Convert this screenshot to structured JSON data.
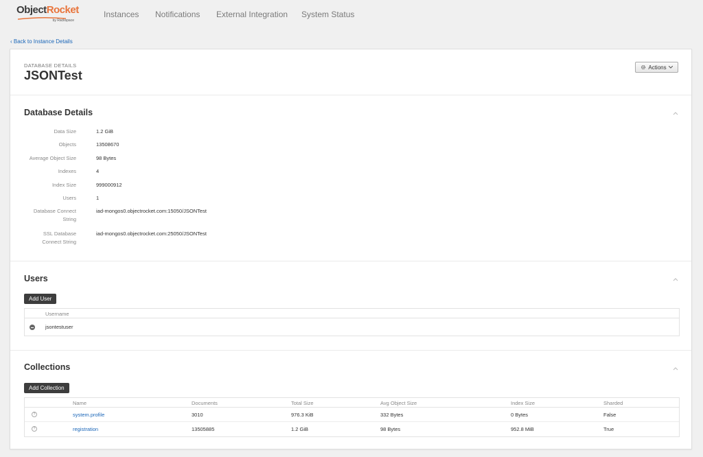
{
  "app": {
    "logo_main": "Object",
    "logo_accent": "Rocket",
    "logo_sub": "by Rackspace",
    "brand_color": "#e8743b"
  },
  "nav": {
    "items": [
      {
        "label": "Instances"
      },
      {
        "label": "Notifications"
      },
      {
        "label": "External Integration"
      },
      {
        "label": "System Status"
      }
    ]
  },
  "breadcrumb": {
    "back_label": "‹ Back to Instance Details"
  },
  "header": {
    "section_label": "DATABASE DETAILS",
    "title": "JSONTest",
    "actions_label": "Actions",
    "actions_icon": "gear-icon"
  },
  "database_details": {
    "title": "Database Details",
    "rows": [
      {
        "label": "Data Size",
        "value": "1.2 GiB"
      },
      {
        "label": "Objects",
        "value": "13508670"
      },
      {
        "label": "Average Object Size",
        "value": "98 Bytes"
      },
      {
        "label": "Indexes",
        "value": "4"
      },
      {
        "label": "Index Size",
        "value": "999000912"
      },
      {
        "label": "Users",
        "value": "1"
      },
      {
        "label": "Database Connect String",
        "value": "iad-mongos0.objectrocket.com:15050/JSONTest"
      },
      {
        "label": "SSL Database Connect String",
        "value": "iad-mongos0.objectrocket.com:25050/JSONTest"
      }
    ]
  },
  "users": {
    "title": "Users",
    "add_label": "Add User",
    "columns": [
      "Username"
    ],
    "rows": [
      {
        "username": "jsontestuser"
      }
    ]
  },
  "collections": {
    "title": "Collections",
    "add_label": "Add Collection",
    "columns": [
      "Name",
      "Documents",
      "Total Size",
      "Avg Object Size",
      "Index Size",
      "Sharded"
    ],
    "rows": [
      {
        "name": "system.profile",
        "documents": "3010",
        "total_size": "976.3 KiB",
        "avg_object_size": "332 Bytes",
        "index_size": "0 Bytes",
        "sharded": "False"
      },
      {
        "name": "registration",
        "documents": "13505885",
        "total_size": "1.2 GiB",
        "avg_object_size": "98 Bytes",
        "index_size": "952.8 MiB",
        "sharded": "True"
      }
    ]
  }
}
